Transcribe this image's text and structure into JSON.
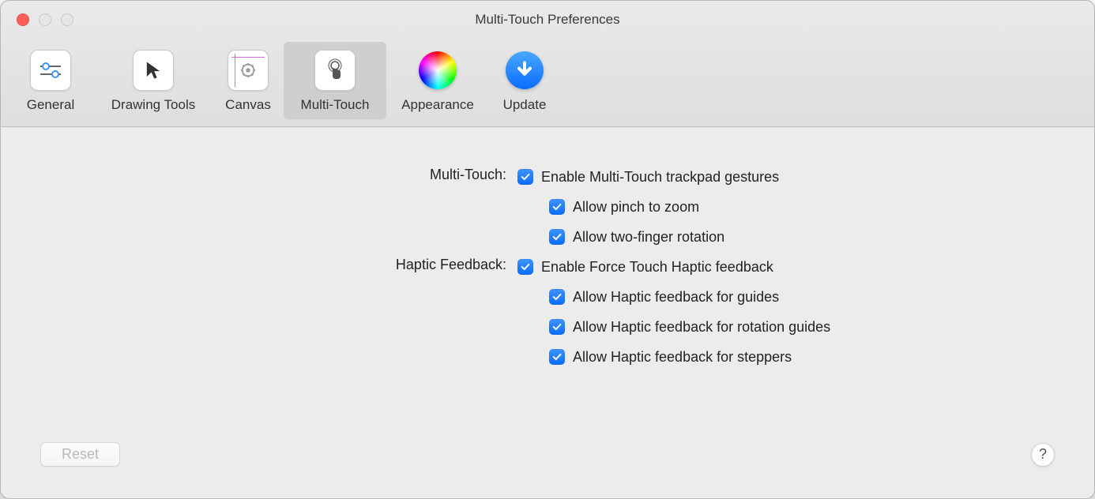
{
  "window": {
    "title": "Multi-Touch Preferences"
  },
  "toolbar": {
    "tabs": [
      {
        "label": "General"
      },
      {
        "label": "Drawing Tools"
      },
      {
        "label": "Canvas"
      },
      {
        "label": "Multi-Touch"
      },
      {
        "label": "Appearance"
      },
      {
        "label": "Update"
      }
    ]
  },
  "sections": {
    "multitouch": {
      "label": "Multi-Touch:",
      "enable": "Enable Multi-Touch trackpad gestures",
      "pinch": "Allow pinch to zoom",
      "rotate": "Allow two-finger rotation"
    },
    "haptic": {
      "label": "Haptic Feedback:",
      "enable": "Enable Force Touch Haptic feedback",
      "guides": "Allow Haptic feedback for guides",
      "rotation": "Allow Haptic feedback for rotation guides",
      "steppers": "Allow Haptic feedback for steppers"
    }
  },
  "footer": {
    "reset": "Reset",
    "help": "?"
  }
}
